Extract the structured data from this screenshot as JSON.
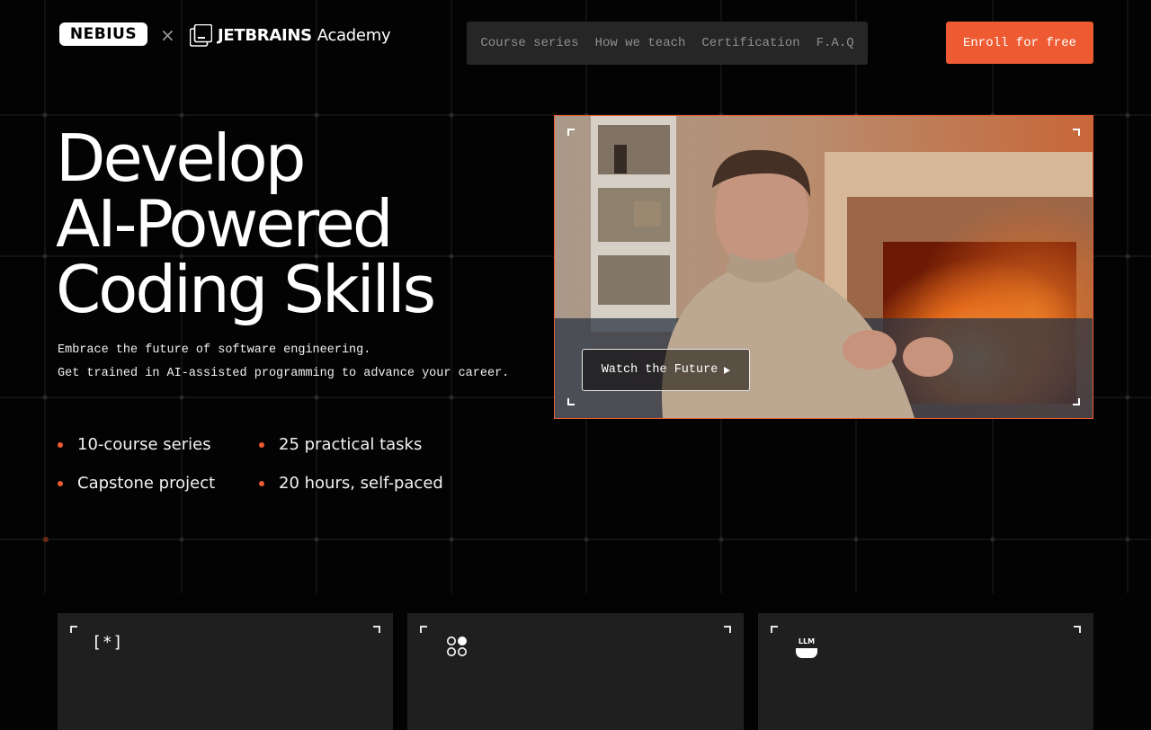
{
  "header": {
    "logo_primary": "NEBIUS",
    "logo_separator": "×",
    "logo_secondary_bold": "JETBRAINS",
    "logo_secondary_light": "Academy",
    "nav": [
      "Course series",
      "How we teach",
      "Certification",
      "F.A.Q"
    ],
    "cta_label": "Enroll for free"
  },
  "hero": {
    "title_lines": [
      "Develop",
      "AI-Powered",
      "Coding Skills"
    ],
    "subtitle_lines": [
      "Embrace the future of software engineering.",
      "Get trained in AI-assisted programming to advance your career."
    ],
    "features": [
      "10-course series",
      "25 practical tasks",
      "Capstone project",
      "20 hours, self-paced"
    ]
  },
  "video": {
    "button_label": "Watch the Future",
    "play_icon": "play-triangle-icon"
  },
  "cards": [
    {
      "icon": "bracket-star-icon",
      "icon_text": "[*]"
    },
    {
      "icon": "four-dots-icon"
    },
    {
      "icon": "llm-cup-icon",
      "icon_text": "LLM"
    }
  ],
  "colors": {
    "accent": "#ee5b32",
    "background": "#030303",
    "nav_bg": "#262626",
    "card_bg": "#1f1f1f"
  }
}
